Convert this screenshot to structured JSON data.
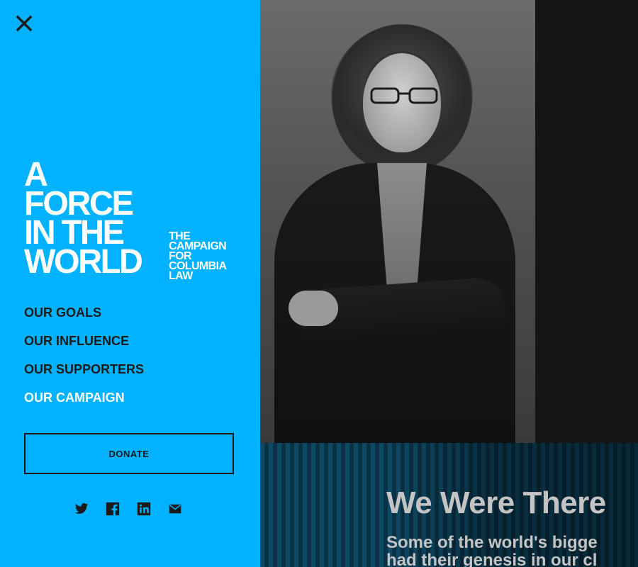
{
  "nav": {
    "close_icon": "close-icon",
    "logo": {
      "main_lines": [
        "A",
        "FORCE",
        "IN THE",
        "WORLD"
      ],
      "sub_lines": [
        "THE",
        "CAMPAIGN",
        "FOR",
        "COLUMBIA",
        "LAW"
      ]
    },
    "menu": [
      {
        "label": "OUR GOALS",
        "active": false
      },
      {
        "label": "OUR INFLUENCE",
        "active": false
      },
      {
        "label": "OUR SUPPORTERS",
        "active": false
      },
      {
        "label": "OUR CAMPAIGN",
        "active": true
      }
    ],
    "donate_label": "DONATE",
    "social": [
      "twitter-icon",
      "facebook-icon",
      "linkedin-icon",
      "email-icon"
    ]
  },
  "content": {
    "band_title": "We Were There",
    "band_sub_lines": [
      "Some of the world's bigge",
      "had their genesis in our cl"
    ]
  },
  "colors": {
    "nav_bg": "#00b2ff",
    "active_menu": "#ffffff",
    "menu_text": "#1a1a1a",
    "band_text": "#c4c4c4"
  }
}
